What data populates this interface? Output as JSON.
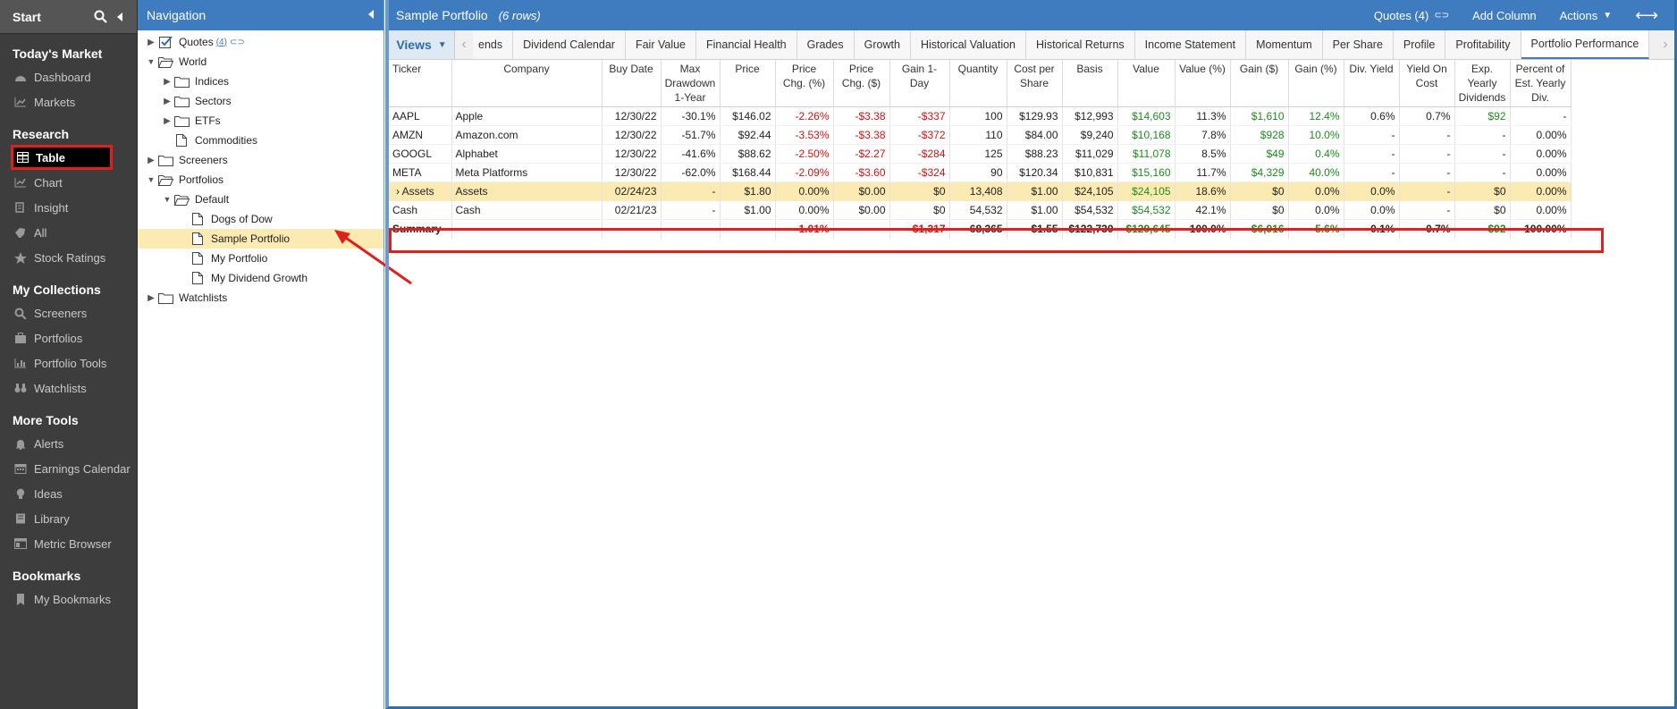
{
  "sidebar": {
    "header": "Start",
    "sections": [
      {
        "title": "Today's Market",
        "items": [
          {
            "label": "Dashboard",
            "icon": "dashboard-icon"
          },
          {
            "label": "Markets",
            "icon": "markets-icon"
          }
        ]
      },
      {
        "title": "Research",
        "items": [
          {
            "label": "Table",
            "icon": "table-icon",
            "active": true
          },
          {
            "label": "Chart",
            "icon": "chart-icon"
          },
          {
            "label": "Insight",
            "icon": "insight-icon"
          },
          {
            "label": "All",
            "icon": "all-icon"
          },
          {
            "label": "Stock Ratings",
            "icon": "star-icon"
          }
        ]
      },
      {
        "title": "My Collections",
        "items": [
          {
            "label": "Screeners",
            "icon": "search-icon"
          },
          {
            "label": "Portfolios",
            "icon": "portfolio-icon"
          },
          {
            "label": "Portfolio Tools",
            "icon": "tools-icon"
          },
          {
            "label": "Watchlists",
            "icon": "binoculars-icon"
          }
        ]
      },
      {
        "title": "More Tools",
        "items": [
          {
            "label": "Alerts",
            "icon": "bell-icon"
          },
          {
            "label": "Earnings Calendar",
            "icon": "calendar-icon"
          },
          {
            "label": "Ideas",
            "icon": "lightbulb-icon"
          },
          {
            "label": "Library",
            "icon": "book-icon"
          },
          {
            "label": "Metric Browser",
            "icon": "browser-icon"
          }
        ]
      },
      {
        "title": "Bookmarks",
        "items": [
          {
            "label": "My Bookmarks",
            "icon": "bookmark-icon"
          }
        ]
      }
    ]
  },
  "nav": {
    "title": "Navigation",
    "tree": [
      {
        "label": "Quotes",
        "badge": "(4)",
        "depth": 0,
        "toggle": "right",
        "icon": "checkbox-icon"
      },
      {
        "label": "World",
        "depth": 0,
        "toggle": "down",
        "icon": "folder-open-icon"
      },
      {
        "label": "Indices",
        "depth": 1,
        "toggle": "right",
        "icon": "folder-icon"
      },
      {
        "label": "Sectors",
        "depth": 1,
        "toggle": "right",
        "icon": "folder-icon"
      },
      {
        "label": "ETFs",
        "depth": 1,
        "toggle": "right",
        "icon": "folder-icon"
      },
      {
        "label": "Commodities",
        "depth": 1,
        "toggle": "",
        "icon": "document-icon"
      },
      {
        "label": "Screeners",
        "depth": 0,
        "toggle": "right",
        "icon": "folder-icon"
      },
      {
        "label": "Portfolios",
        "depth": 0,
        "toggle": "down",
        "icon": "folder-open-icon"
      },
      {
        "label": "Default",
        "depth": 1,
        "toggle": "down",
        "icon": "folder-open-icon"
      },
      {
        "label": "Dogs of Dow",
        "depth": 2,
        "toggle": "",
        "icon": "document-icon"
      },
      {
        "label": "Sample Portfolio",
        "depth": 2,
        "toggle": "",
        "icon": "document-icon",
        "selected": true
      },
      {
        "label": "My Portfolio",
        "depth": 2,
        "toggle": "",
        "icon": "document-icon"
      },
      {
        "label": "My Dividend Growth",
        "depth": 2,
        "toggle": "",
        "icon": "document-icon"
      },
      {
        "label": "Watchlists",
        "depth": 0,
        "toggle": "right",
        "icon": "folder-icon"
      }
    ]
  },
  "main": {
    "title": "Sample Portfolio",
    "rows_label": "(6 rows)",
    "header_buttons": {
      "quotes": "Quotes (4)",
      "add_column": "Add Column",
      "actions": "Actions"
    },
    "views_label": "Views",
    "tabs": [
      "ends",
      "Dividend Calendar",
      "Fair Value",
      "Financial Health",
      "Grades",
      "Growth",
      "Historical Valuation",
      "Historical Returns",
      "Income Statement",
      "Momentum",
      "Per Share",
      "Profile",
      "Profitability",
      "Portfolio Performance"
    ],
    "active_tab": "Portfolio Performance",
    "columns": [
      "Ticker",
      "Company",
      "Buy Date",
      "Max Drawdown 1-Year",
      "Price",
      "Price Chg. (%)",
      "Price Chg. ($)",
      "Gain 1-Day",
      "Quantity",
      "Cost per Share",
      "Basis",
      "Value",
      "Value (%)",
      "Gain ($)",
      "Gain (%)",
      "Div. Yield",
      "Yield On Cost",
      "Exp. Yearly Dividends",
      "Percent of Est. Yearly Div."
    ],
    "rows": [
      {
        "type": "body",
        "cells": [
          "AAPL",
          "Apple",
          "12/30/22",
          "-30.1%",
          "$146.02",
          "-2.26%",
          "-$3.38",
          "-$337",
          "100",
          "$129.93",
          "$12,993",
          "$14,603",
          "11.3%",
          "$1,610",
          "12.4%",
          "0.6%",
          "0.7%",
          "$92",
          "-"
        ]
      },
      {
        "type": "body",
        "cells": [
          "AMZN",
          "Amazon.com",
          "12/30/22",
          "-51.7%",
          "$92.44",
          "-3.53%",
          "-$3.38",
          "-$372",
          "110",
          "$84.00",
          "$9,240",
          "$10,168",
          "7.8%",
          "$928",
          "10.0%",
          "-",
          "-",
          "-",
          "0.00%"
        ]
      },
      {
        "type": "body",
        "cells": [
          "GOOGL",
          "Alphabet",
          "12/30/22",
          "-41.6%",
          "$88.62",
          "-2.50%",
          "-$2.27",
          "-$284",
          "125",
          "$88.23",
          "$11,029",
          "$11,078",
          "8.5%",
          "$49",
          "0.4%",
          "-",
          "-",
          "-",
          "0.00%"
        ]
      },
      {
        "type": "body",
        "cells": [
          "META",
          "Meta Platforms",
          "12/30/22",
          "-62.0%",
          "$168.44",
          "-2.09%",
          "-$3.60",
          "-$324",
          "90",
          "$120.34",
          "$10,831",
          "$15,160",
          "11.7%",
          "$4,329",
          "40.0%",
          "-",
          "-",
          "-",
          "0.00%"
        ]
      },
      {
        "type": "assets",
        "cells": [
          "Assets",
          "Assets",
          "02/24/23",
          "-",
          "$1.80",
          "0.00%",
          "$0.00",
          "$0",
          "13,408",
          "$1.00",
          "$24,105",
          "$24,105",
          "18.6%",
          "$0",
          "0.0%",
          "0.0%",
          "-",
          "$0",
          "0.00%"
        ]
      },
      {
        "type": "body",
        "cells": [
          "Cash",
          "Cash",
          "02/21/23",
          "-",
          "$1.00",
          "0.00%",
          "$0.00",
          "$0",
          "54,532",
          "$1.00",
          "$54,532",
          "$54,532",
          "42.1%",
          "$0",
          "0.0%",
          "0.0%",
          "-",
          "$0",
          "0.00%"
        ]
      },
      {
        "type": "summary",
        "cells": [
          "Summary",
          "",
          "",
          "",
          "",
          "-1.01%",
          "",
          "-$1,317",
          "68,365",
          "$1.55",
          "$122,730",
          "$129,645",
          "100.0%",
          "$6,916",
          "5.6%",
          "0.1%",
          "0.7%",
          "$92",
          "100.00%"
        ]
      }
    ],
    "colors": {
      "header_blue": "#3f7cbf",
      "positive": "#1e8a1e",
      "negative": "#d01414",
      "highlight": "#fbeab1",
      "annotation_red": "#e0201b"
    }
  }
}
